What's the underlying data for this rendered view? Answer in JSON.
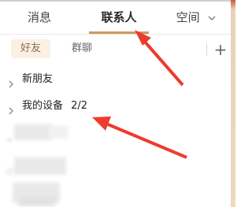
{
  "tabs": [
    {
      "label": "消息"
    },
    {
      "label": "联系人"
    },
    {
      "label": "空间"
    }
  ],
  "active_tab": "联系人",
  "segments": {
    "friends_label": "好友",
    "groups_label": "群聊",
    "add_label": "+"
  },
  "groups": [
    {
      "label": "新朋友",
      "count": ""
    },
    {
      "label": "我的设备",
      "count": "2/2"
    }
  ],
  "colors": {
    "active_underline": "#c79b5f",
    "friends_bg": "#fbf0e4",
    "annotation_arrow": "#ee3b2f"
  }
}
